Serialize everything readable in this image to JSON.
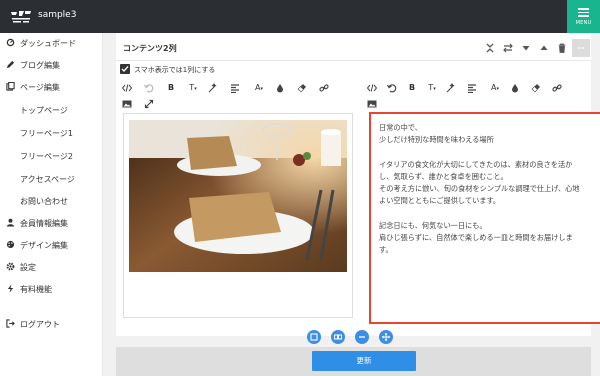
{
  "header": {
    "site_name": "sample3",
    "menu_label": "MENU",
    "brand_color": "#2b2f33",
    "menu_color": "#19b58f"
  },
  "sidebar": {
    "items": [
      {
        "label": "ダッシュボード",
        "icon": "dashboard-icon"
      },
      {
        "label": "ブログ編集",
        "icon": "pencil-icon"
      },
      {
        "label": "ページ編集",
        "icon": "pages-icon"
      },
      {
        "label": "トップページ",
        "icon": ""
      },
      {
        "label": "フリーページ1",
        "icon": ""
      },
      {
        "label": "フリーページ2",
        "icon": ""
      },
      {
        "label": "アクセスページ",
        "icon": ""
      },
      {
        "label": "お問い合わせ",
        "icon": ""
      },
      {
        "label": "会員情報編集",
        "icon": "user-icon"
      },
      {
        "label": "デザイン編集",
        "icon": "palette-icon"
      },
      {
        "label": "設定",
        "icon": "gear-icon"
      },
      {
        "label": "有料機能",
        "icon": "bolt-icon"
      },
      {
        "label": "ログアウト",
        "icon": "logout-icon"
      }
    ]
  },
  "editor": {
    "block_title": "コンテンツ2列",
    "sp_option_label": "スマホ表示では1列にする",
    "sp_option_checked": true,
    "toolbar_bold": "B",
    "toolbar_font_size": "T",
    "toolbar_font_color": "A",
    "text_lines": [
      "日常の中で、",
      "少しだけ特別な時間を味わえる場所",
      "",
      "イタリアの食文化が大切にしてきたのは、素材の良さを活か",
      "し、気取らず、誰かと食卓を囲むこと。",
      "その考え方に倣い、旬の食材をシンプルな調理で仕上げ、心地",
      "よい空間とともにご提供しています。",
      "",
      "記念日にも、何気ない一日にも。",
      "肩ひじ張らずに、自然体で楽しめる一皿と時間をお届けしま",
      "す。"
    ],
    "highlight_color": "#e5442f"
  },
  "footer": {
    "update_label": "更新",
    "button_color": "#2f8ee5"
  }
}
